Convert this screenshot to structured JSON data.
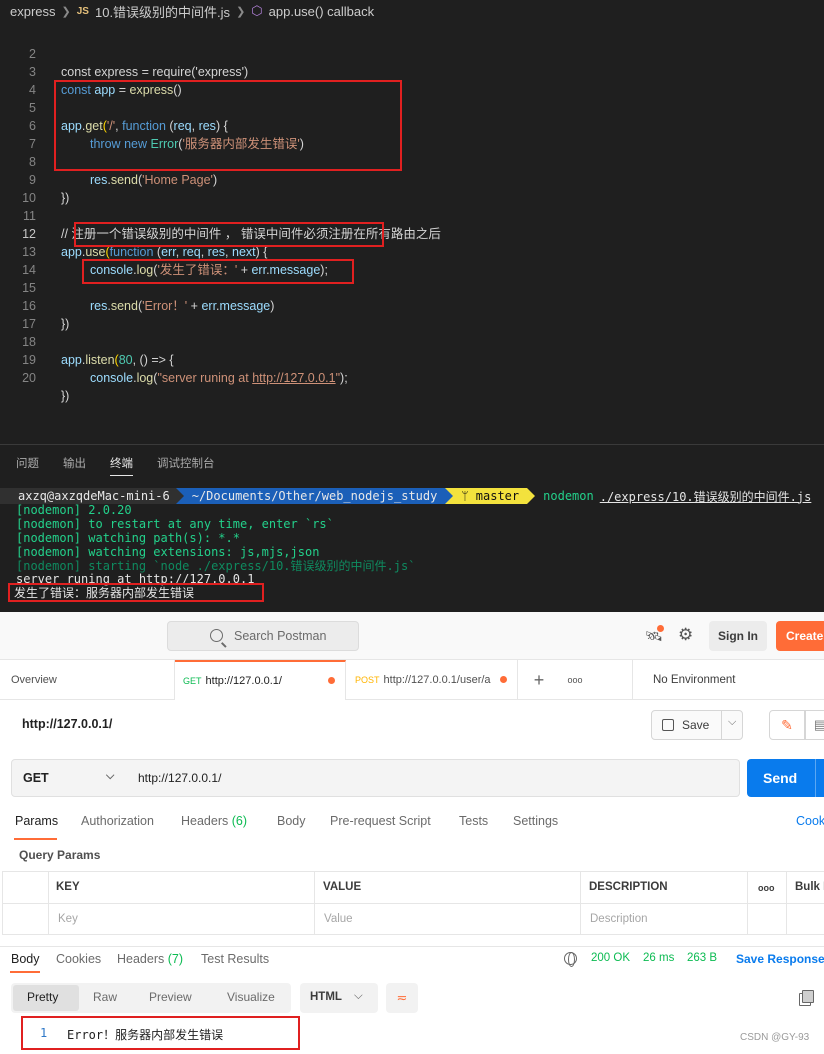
{
  "editor": {
    "breadcrumb": {
      "folder": "express",
      "file_tag": "JS",
      "file": "10.错误级别的中间件.js",
      "symbol": "app.use() callback"
    },
    "lines": [
      {
        "n": "2",
        "text": "const express = require('express')"
      },
      {
        "n": "3",
        "text": "const app = express()"
      },
      {
        "n": "4",
        "text": ""
      },
      {
        "n": "5",
        "text": "app.get('/', function (req, res) {"
      },
      {
        "n": "6",
        "text": "throw new Error('服务器内部发生错误')"
      },
      {
        "n": "7",
        "text": ""
      },
      {
        "n": "8",
        "text": "res.send('Home Page')"
      },
      {
        "n": "9",
        "text": "})"
      },
      {
        "n": "10",
        "text": ""
      },
      {
        "n": "11",
        "text": "// 注册一个错误级别的中间件 ， 错误中间件必须注册在所有路由之后"
      },
      {
        "n": "12",
        "text": "app.use(function (err, req, res, next) {"
      },
      {
        "n": "13",
        "text": "console.log('发生了错误：' + err.message);"
      },
      {
        "n": "14",
        "text": ""
      },
      {
        "n": "15",
        "text": "res.send('Error！' + err.message)"
      },
      {
        "n": "16",
        "text": "})"
      },
      {
        "n": "17",
        "text": ""
      },
      {
        "n": "18",
        "text": "app.listen(80, () => {"
      },
      {
        "n": "19",
        "text": "console.log(\"server runing at http://127.0.0.1\");"
      },
      {
        "n": "20",
        "text": "})"
      }
    ],
    "tokens": {
      "l3": [
        "const",
        "app",
        "=",
        "express",
        "()"
      ],
      "l5": [
        "app",
        ".",
        "get",
        "(",
        "'/'",
        ", ",
        "function",
        " (",
        "req",
        ", ",
        "res",
        ") {"
      ],
      "l6": [
        "throw",
        "new",
        "Error",
        "(",
        "'服务器内部发生错误'",
        ")"
      ],
      "l8": [
        "res",
        ".",
        "send",
        "(",
        "'Home Page'",
        ")"
      ],
      "l12": [
        "app",
        ".",
        "use",
        "(",
        "function",
        " (",
        "err",
        ", ",
        "req",
        ", ",
        "res",
        ", ",
        "next",
        ") {"
      ],
      "l13": [
        "console",
        ".",
        "log",
        "(",
        "'发生了错误：'",
        " + ",
        "err",
        ".",
        "message",
        ");"
      ],
      "l15": [
        "res",
        ".",
        "send",
        "(",
        "'Error！'",
        " + ",
        "err",
        ".",
        "message",
        ")"
      ],
      "l18": [
        "app",
        ".",
        "listen",
        "(",
        "80",
        ", () => {"
      ],
      "l19": [
        "console",
        ".",
        "log",
        "(",
        "\"server runing at ",
        "http://127.0.0.1",
        "\"",
        ");"
      ]
    }
  },
  "panel": {
    "tabs": [
      "问题",
      "输出",
      "终端",
      "调试控制台"
    ],
    "active_tab": "终端"
  },
  "terminal": {
    "prompt_user": "axzq@axzqdeMac-mini-6",
    "prompt_path": "~/Documents/Other/web_nodejs_study",
    "prompt_branch": "ᛘ master",
    "prompt_cmd": "nodemon",
    "prompt_arg": "./express/10.错误级别的中间件.js",
    "lines": [
      "[nodemon] 2.0.20",
      "[nodemon] to restart at any time, enter `rs`",
      "[nodemon] watching path(s): *.*",
      "[nodemon] watching extensions: js,mjs,json",
      "[nodemon] starting `node ./express/10.错误级别的中间件.js`",
      "server runing at http://127.0.0.1",
      "发生了错误：服务器内部发生错误"
    ]
  },
  "postman": {
    "search_placeholder": "Search Postman",
    "sign_in": "Sign In",
    "create": "Create",
    "tabs": [
      {
        "label": "Overview"
      },
      {
        "method": "GET",
        "label": "http://127.0.0.1/"
      },
      {
        "method": "POST",
        "label": "http://127.0.0.1/user/a"
      }
    ],
    "plus": "+",
    "more": "ooo",
    "environment": "No Environment",
    "request_title": "http://127.0.0.1/",
    "save": "Save",
    "method": "GET",
    "url": "http://127.0.0.1/",
    "send": "Send",
    "req_tabs": {
      "params": "Params",
      "authorization": "Authorization",
      "headers": "Headers",
      "headers_count": "(6)",
      "body": "Body",
      "prerequest": "Pre-request Script",
      "tests": "Tests",
      "settings": "Settings",
      "cookies": "Cook"
    },
    "query_params": "Query Params",
    "table": {
      "key": "KEY",
      "value": "VALUE",
      "description": "DESCRIPTION",
      "more": "ooo",
      "bulk": "Bulk E",
      "key_ph": "Key",
      "value_ph": "Value",
      "description_ph": "Description"
    },
    "resp_tabs": {
      "body": "Body",
      "cookies": "Cookies",
      "headers": "Headers",
      "headers_count": "(7)",
      "test_results": "Test Results"
    },
    "status": "200 OK",
    "time": "26 ms",
    "size": "263 B",
    "save_response": "Save Response",
    "formats": [
      "Pretty",
      "Raw",
      "Preview",
      "Visualize"
    ],
    "lang": "HTML",
    "response_line": "1",
    "response_text": "Error！服务器内部发生错误",
    "watermark": "CSDN @GY-93"
  },
  "colors": {
    "accent": "#ff6c37",
    "send": "#097bed",
    "status_ok": "#0cbb52",
    "highlight_box": "#e02020"
  }
}
